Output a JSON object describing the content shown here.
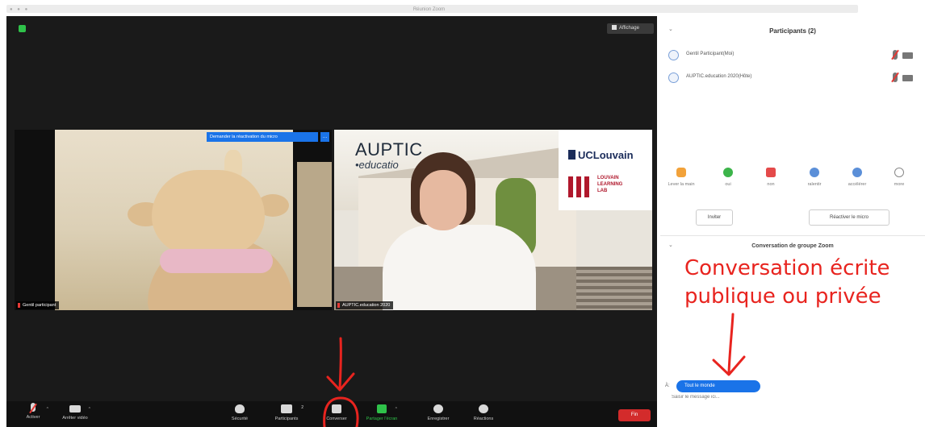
{
  "window": {
    "title": "Réunion Zoom"
  },
  "main": {
    "view_label": "Affichage",
    "request_button_label": "Demander la réactivation du micro",
    "tile_1": {
      "name": "Gentil participant"
    },
    "tile_2": {
      "name": "AUPTIC.education 2020",
      "slide_title": "AUPTIC",
      "slide_subtitle": "•educatio",
      "logo_text": "UCLouvain",
      "lab_line1": "LOUVAIN",
      "lab_line2": "LEARNING",
      "lab_line3": "LAB"
    }
  },
  "toolbar": {
    "unmute": "Activer",
    "stop_video": "Arrêter vidéo",
    "security": "Sécurité",
    "participants": "Participants",
    "participants_count": "2",
    "chat": "Converser",
    "share": "Partager l'écran",
    "record": "Enregistrer",
    "reactions": "Réactions",
    "end": "Fin"
  },
  "panel": {
    "title": "Participants (2)",
    "participants": [
      {
        "name": "Gentil Participant(Moi)"
      },
      {
        "name": "AUPTIC.education 2020(Hôte)"
      }
    ],
    "reactions": {
      "raise_hand": "Lever la main",
      "yes": "oui",
      "no": "non",
      "slower": "ralentir",
      "faster": "accélérer",
      "more": "more"
    },
    "invite_button": "Inviter",
    "unmute_button": "Réactiver le micro",
    "chat_title": "Conversation de groupe Zoom",
    "to_label": "À:",
    "recipient": "Tout le monde",
    "input_placeholder": "Saisir le message ici..."
  },
  "annotation": {
    "line1": "Conversation écrite",
    "line2": "publique ou privée"
  },
  "colors": {
    "accent_blue": "#1a73e8",
    "annotation_red": "#e8241f",
    "end_red": "#d32b2b",
    "share_green": "#2fc24a"
  }
}
